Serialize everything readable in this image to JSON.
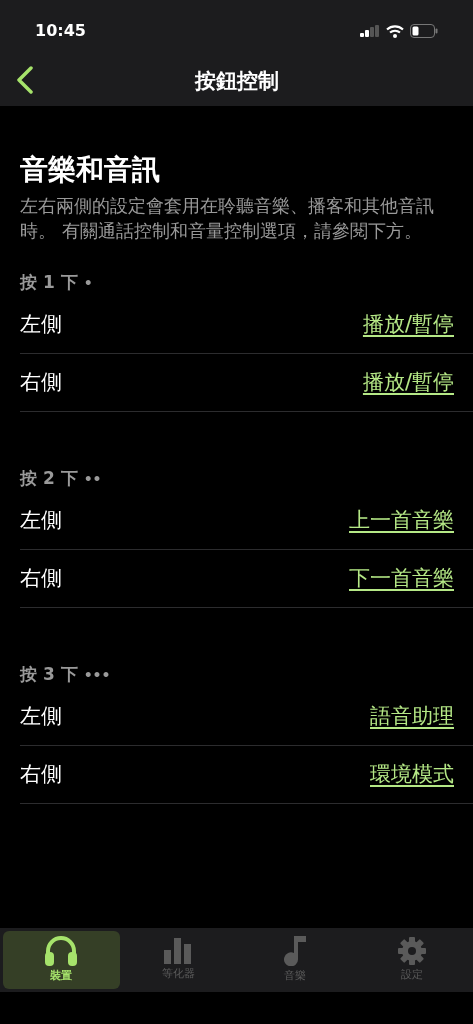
{
  "status_bar": {
    "time": "10:45"
  },
  "nav": {
    "title": "按鈕控制"
  },
  "section": {
    "title": "音樂和音訊",
    "description": "左右兩側的設定會套用在聆聽音樂、播客和其他音訊時。 有關通話控制和音量控制選項，請參閱下方。"
  },
  "groups": [
    {
      "label": "按 1 下",
      "dots": "•",
      "rows": [
        {
          "side": "左側",
          "action": "播放/暫停"
        },
        {
          "side": "右側",
          "action": "播放/暫停"
        }
      ]
    },
    {
      "label": "按 2 下",
      "dots": "••",
      "rows": [
        {
          "side": "左側",
          "action": "上一首音樂"
        },
        {
          "side": "右側",
          "action": "下一首音樂"
        }
      ]
    },
    {
      "label": "按 3 下",
      "dots": "•••",
      "rows": [
        {
          "side": "左側",
          "action": "語音助理"
        },
        {
          "side": "右側",
          "action": "環境模式"
        }
      ]
    }
  ],
  "tab_bar": [
    {
      "label": "裝置",
      "kind": "headphones",
      "selected": true
    },
    {
      "label": "等化器",
      "kind": "equalizer",
      "selected": false
    },
    {
      "label": "音樂",
      "kind": "music",
      "selected": false
    },
    {
      "label": "設定",
      "kind": "settings",
      "selected": false
    }
  ]
}
